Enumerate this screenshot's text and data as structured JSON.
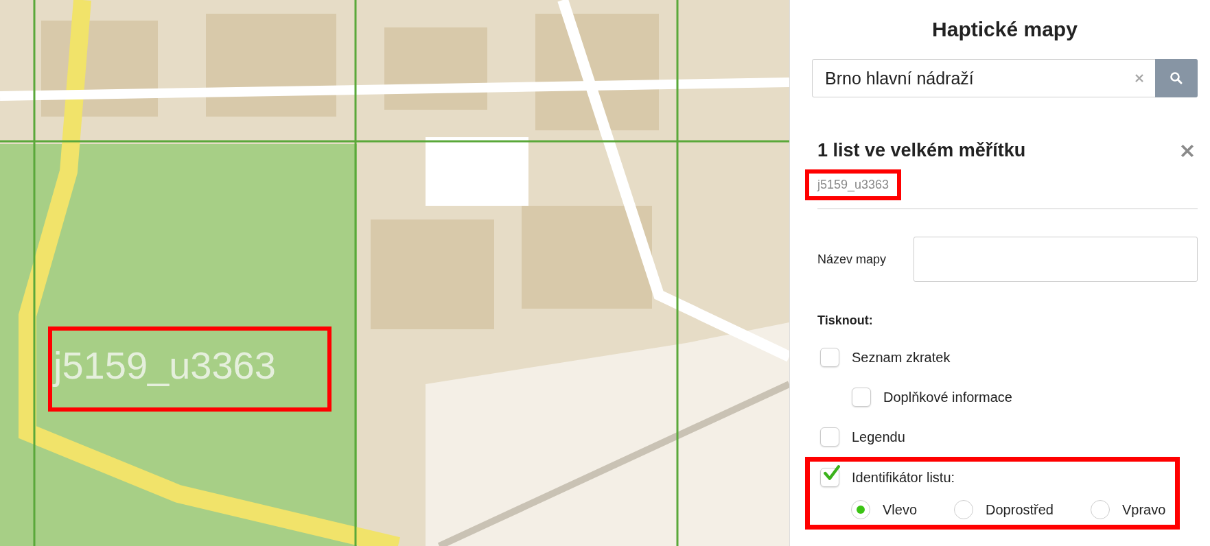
{
  "app": {
    "title": "Haptické mapy"
  },
  "search": {
    "value": "Brno hlavní nádraží"
  },
  "map": {
    "sheet_label": "j5159_u3363"
  },
  "sheet_panel": {
    "heading": "1 list ve velkém měřítku",
    "sheet_id": "j5159_u3363"
  },
  "map_name": {
    "label": "Název mapy"
  },
  "print": {
    "heading": "Tisknout:",
    "options": [
      {
        "label": "Seznam zkratek",
        "checked": false,
        "children": [
          {
            "label": "Doplňkové informace",
            "checked": false
          }
        ]
      },
      {
        "label": "Legendu",
        "checked": false
      },
      {
        "label": "Identifikátor listu:",
        "checked": true
      }
    ],
    "positions": [
      {
        "label": "Vlevo",
        "selected": true
      },
      {
        "label": "Doprostřed",
        "selected": false
      },
      {
        "label": "Vpravo",
        "selected": false
      }
    ]
  }
}
